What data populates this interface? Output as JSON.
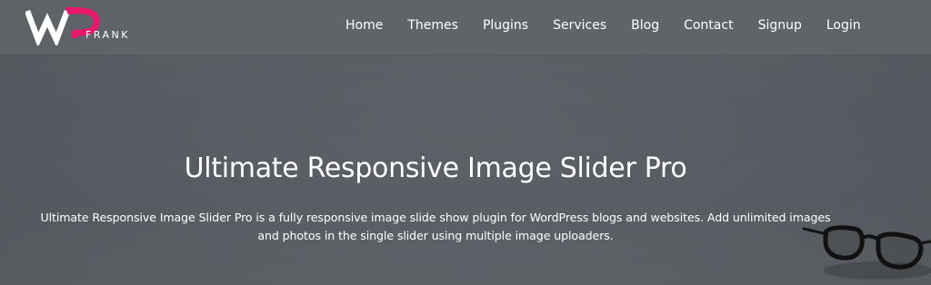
{
  "brand": {
    "logo_mark": "WP",
    "logo_word": "FRANK",
    "accent": "#e8196c"
  },
  "nav": {
    "items": [
      {
        "label": "Home"
      },
      {
        "label": "Themes"
      },
      {
        "label": "Plugins"
      },
      {
        "label": "Services"
      },
      {
        "label": "Blog"
      },
      {
        "label": "Contact"
      },
      {
        "label": "Signup"
      },
      {
        "label": "Login"
      }
    ]
  },
  "hero": {
    "title": "Ultimate Responsive Image Slider Pro",
    "description": "Ultimate Responsive Image Slider Pro is a fully responsive image slide show plugin for WordPress blogs and websites. Add unlimited images and photos in the single slider using multiple image uploaders."
  },
  "decor": {
    "image": "eyeglasses-icon"
  }
}
